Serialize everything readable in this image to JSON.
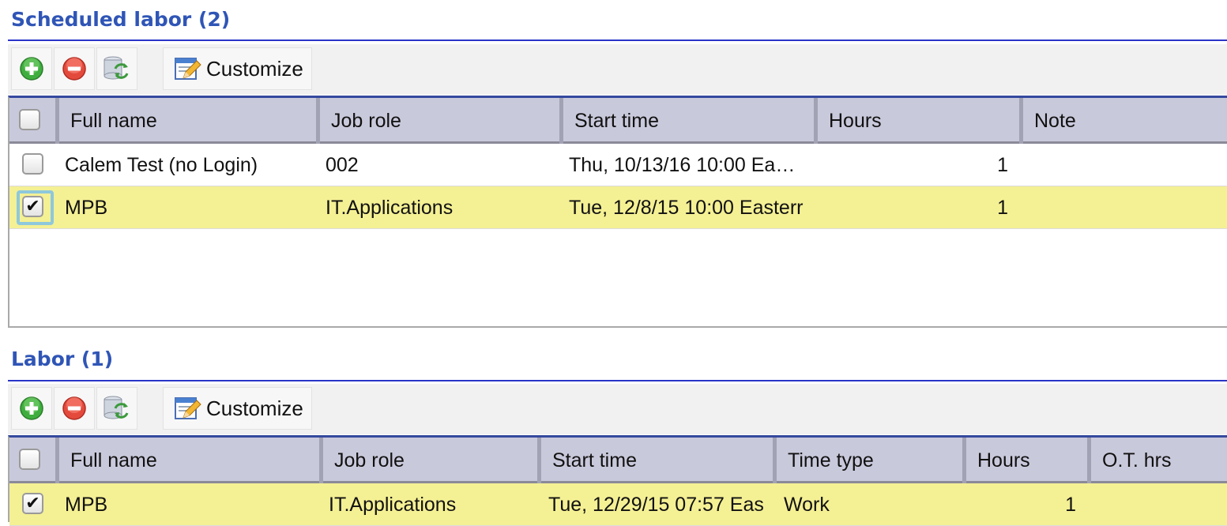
{
  "scheduled": {
    "title": "Scheduled labor (2)",
    "toolbar": {
      "add_icon": "add-circle-icon",
      "remove_icon": "remove-circle-icon",
      "refresh_icon": "refresh-icon",
      "customize_label": "Customize"
    },
    "columns": [
      "Full name",
      "Job role",
      "Start time",
      "Hours",
      "Note"
    ],
    "rows": [
      {
        "full_name": "Calem Test (no Login)",
        "job_role": "002",
        "start_time": "Thu, 10/13/16 10:00 Ea…",
        "hours": "1",
        "note": "",
        "checked": false
      },
      {
        "full_name": "MPB",
        "job_role": "IT.Applications",
        "start_time": "Tue, 12/8/15 10:00 Easterr",
        "hours": "1",
        "note": "",
        "checked": true
      }
    ]
  },
  "labor": {
    "title": "Labor (1)",
    "toolbar": {
      "customize_label": "Customize"
    },
    "columns": [
      "Full name",
      "Job role",
      "Start time",
      "Time type",
      "Hours",
      "O.T. hrs"
    ],
    "rows": [
      {
        "full_name": "MPB",
        "job_role": "IT.Applications",
        "start_time": "Tue, 12/29/15 07:57 Eas",
        "time_type": "Work",
        "hours": "1",
        "ot_hrs": "",
        "checked": true
      }
    ]
  },
  "colors": {
    "section_title": "#2f55b6",
    "header_bg": "#c9c9dc",
    "selected_row": "#f4f094",
    "title_rule": "#2a35c8"
  }
}
